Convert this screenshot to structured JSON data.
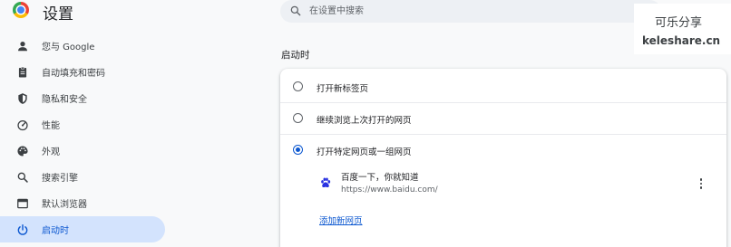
{
  "header": {
    "title": "设置",
    "logo_icon": "chrome-logo-icon"
  },
  "search": {
    "placeholder": "在设置中搜索",
    "value": "",
    "icon": "search-icon"
  },
  "watermark": {
    "title": "可乐分享",
    "url": "keleshare.cn"
  },
  "sidebar": {
    "items": [
      {
        "label": "您与 Google",
        "icon": "person-icon",
        "active": false
      },
      {
        "label": "自动填充和密码",
        "icon": "clipboard-icon",
        "active": false
      },
      {
        "label": "隐私和安全",
        "icon": "shield-icon",
        "active": false
      },
      {
        "label": "性能",
        "icon": "speedometer-icon",
        "active": false
      },
      {
        "label": "外观",
        "icon": "palette-icon",
        "active": false
      },
      {
        "label": "搜索引擎",
        "icon": "search-icon",
        "active": false
      },
      {
        "label": "默认浏览器",
        "icon": "browser-icon",
        "active": false
      },
      {
        "label": "启动时",
        "icon": "power-icon",
        "active": true
      }
    ]
  },
  "startup": {
    "section_title": "启动时",
    "options": [
      {
        "label": "打开新标签页",
        "checked": false
      },
      {
        "label": "继续浏览上次打开的网页",
        "checked": false
      },
      {
        "label": "打开特定网页或一组网页",
        "checked": true
      }
    ],
    "pages": [
      {
        "name": "百度一下，你就知道",
        "url": "https://www.baidu.com/",
        "icon": "baidu-paw-icon"
      }
    ],
    "add_page_label": "添加新网页"
  },
  "colors": {
    "accent": "#0b57d0",
    "active_nav_bg": "#d3e3fd",
    "page_bg": "#f8f9fa",
    "search_bg": "#edf0f4",
    "baidu_blue": "#2932e1"
  }
}
